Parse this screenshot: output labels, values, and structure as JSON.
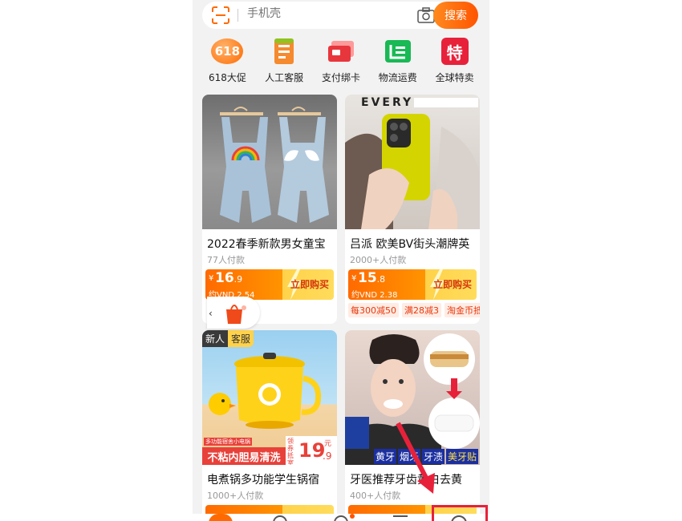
{
  "search": {
    "placeholder": "手机壳",
    "button_label": "搜索"
  },
  "quick_entries": [
    {
      "label": "618大促",
      "icon": "618-badge-icon",
      "badge": "618"
    },
    {
      "label": "人工客服",
      "icon": "customer-service-icon"
    },
    {
      "label": "支付绑卡",
      "icon": "payment-card-icon"
    },
    {
      "label": "物流运费",
      "icon": "logistics-icon"
    },
    {
      "label": "全球特卖",
      "icon": "global-sale-icon",
      "badge": "特"
    }
  ],
  "products": [
    {
      "title": "2022春季新款男女童宝",
      "sold": "77人付款",
      "price_symbol": "¥",
      "price_int": "16",
      "price_dec": ".9",
      "vnd": "约VND 2.54",
      "buy_label": "立即购买"
    },
    {
      "title": "吕派 欧美BV街头潮牌英",
      "sold": "2000+人付款",
      "price_symbol": "¥",
      "price_int": "15",
      "price_dec": ".8",
      "vnd": "约VND 2.38",
      "buy_label": "立即购买",
      "image_text": "EVERY",
      "tags": [
        "每300减50",
        "满28减3",
        "淘金币抵"
      ]
    },
    {
      "title": "电煮锅多功能学生锅宿",
      "sold": "1000+人付款",
      "image_labels": {
        "new": "新人",
        "service": "客服",
        "banner": "不粘内胆易清洗",
        "small": "多功能宿舍小电锅",
        "price": "19",
        "price_dec": ".9",
        "yuan": "元",
        "promo": "领券抵室"
      }
    },
    {
      "title": "牙医推荐牙齿黄白去黄",
      "sold": "400+人付款",
      "image_labels": {
        "b1": "黄牙",
        "b2": "烟牙",
        "b3": "牙渍",
        "b4": "美牙贴"
      }
    }
  ],
  "colors": {
    "accent": "#ff5400",
    "price_bar": "#ff7a00",
    "highlight": "#e8213a"
  }
}
